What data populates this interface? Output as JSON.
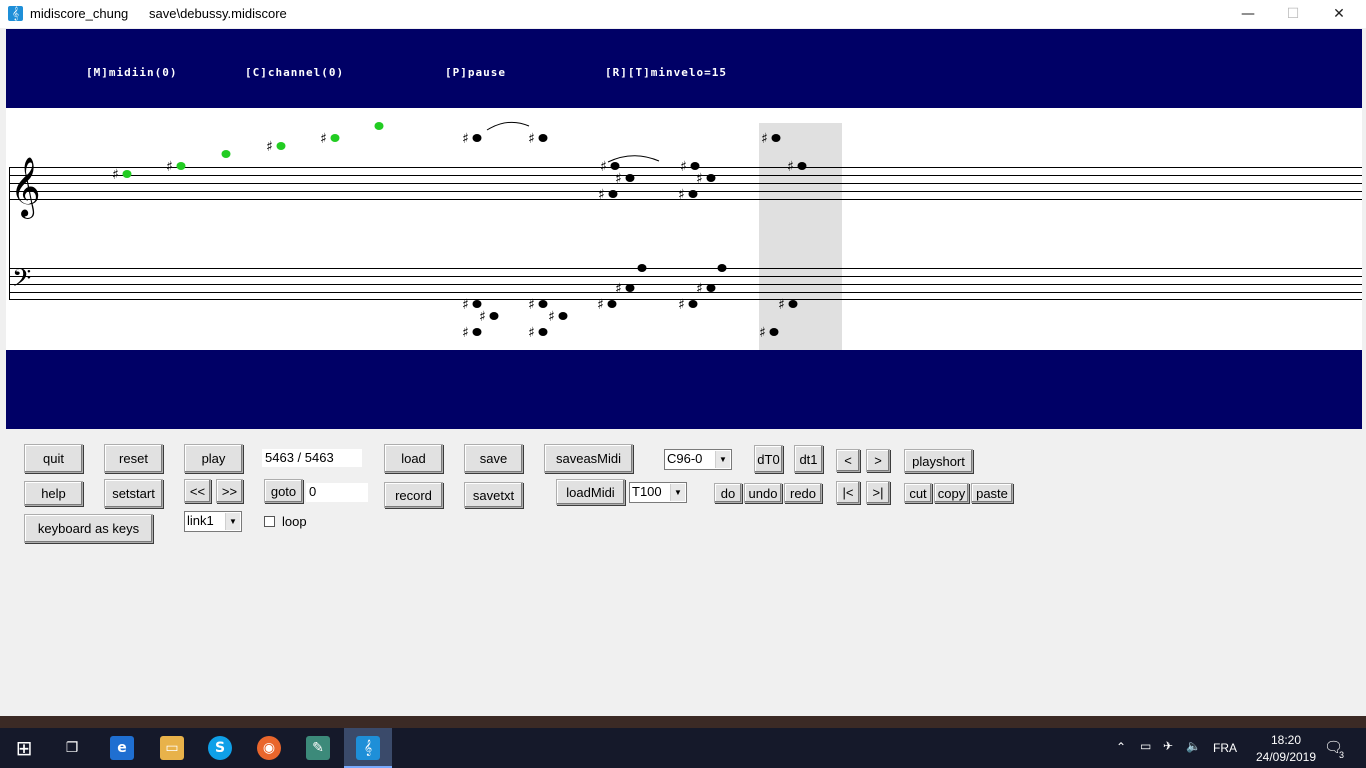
{
  "window": {
    "app_title": "midiscore_chung",
    "doc_title": "save\\debussy.midiscore",
    "app_icon": "treble-clef-icon",
    "minimize": "—",
    "maximize": "☐",
    "close": "✕"
  },
  "status_bar": {
    "midiin": "[M]midiin(0)",
    "channel": "[C]channel(0)",
    "pause": "[P]pause",
    "minvelo": "[R][T]minvelo=15"
  },
  "score": {
    "treble_clef": "𝄞",
    "bass_clef": "𝄢",
    "sharp": "♯",
    "highlight_color": "#e0e0e0",
    "played_note_color": "#22cc22",
    "note_color": "#000000"
  },
  "controls": {
    "quit": "quit",
    "reset": "reset",
    "play": "play",
    "position": "5463 / 5463",
    "load": "load",
    "save": "save",
    "saveasmidi": "saveasMidi",
    "c96_select": "C96-0",
    "dt0": "dT0",
    "dt1": "dt1",
    "prev": "<",
    "next": ">",
    "playshort": "playshort",
    "help": "help",
    "setstart": "setstart",
    "rewind": "<<",
    "forward": ">>",
    "goto": "goto",
    "goto_value": "0",
    "record": "record",
    "savetxt": "savetxt",
    "loadmidi": "loadMidi",
    "tempo_select": "T100",
    "do": "do",
    "undo": "undo",
    "redo": "redo",
    "first": "|<",
    "last": ">|",
    "cut": "cut",
    "copy": "copy",
    "paste": "paste",
    "keyboard_as_keys": "keyboard as keys",
    "link_select": "link1",
    "loop": "loop"
  },
  "taskbar": {
    "lang": "FRA",
    "time": "18:20",
    "date": "24/09/2019",
    "notifications": "3"
  }
}
